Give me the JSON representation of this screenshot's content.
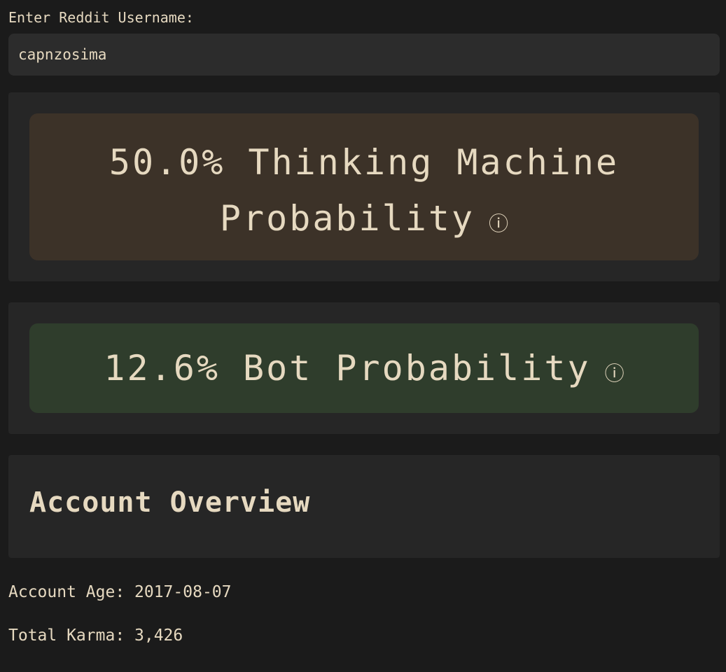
{
  "form": {
    "label": "Enter Reddit Username:",
    "username_value": "capnzosima"
  },
  "results": {
    "thinking_machine": {
      "text": "50.0% Thinking Machine Probability",
      "probability_percent": 50.0,
      "info_icon": "ⓘ",
      "color": "#3c3228"
    },
    "bot": {
      "text": "12.6% Bot Probability",
      "probability_percent": 12.6,
      "info_icon": "ⓘ",
      "color": "#2f3d2c"
    }
  },
  "overview": {
    "title": "Account Overview",
    "account_age": "Account Age: 2017-08-07",
    "total_karma": "Total Karma: 3,426"
  },
  "colors": {
    "background": "#1b1b1b",
    "panel": "#262626",
    "text": "#e6d9c0"
  }
}
